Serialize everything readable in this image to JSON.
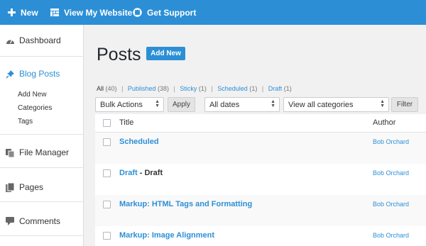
{
  "topbar": {
    "new_label": "New",
    "view_site_label": "View My Website",
    "support_label": "Get Support",
    "icons": [
      "plus-icon",
      "site-grid-icon",
      "lifebuoy-icon"
    ],
    "accent_color": "#2c8fd6"
  },
  "sidebar": {
    "dashboard": "Dashboard",
    "blog_posts": "Blog Posts",
    "sub": [
      "Add New",
      "Categories",
      "Tags"
    ],
    "file_manager": "File Manager",
    "pages": "Pages",
    "comments": "Comments"
  },
  "page": {
    "title": "Posts",
    "add_new": "Add New"
  },
  "filters": {
    "all": "All",
    "all_count": "(40)",
    "published": "Published",
    "published_count": "(38)",
    "sticky": "Sticky",
    "sticky_count": "(1)",
    "scheduled": "Scheduled",
    "scheduled_count": "(1)",
    "draft": "Draft",
    "draft_count": "(1)",
    "separator": "|"
  },
  "toolbar": {
    "bulk_actions": "Bulk Actions",
    "apply": "Apply",
    "dates": "All dates",
    "categories": "View all categories",
    "filter": "Filter"
  },
  "table": {
    "col_title": "Title",
    "col_author": "Author",
    "rows": [
      {
        "title": "Scheduled",
        "state": "",
        "author": "Bob Orchard"
      },
      {
        "title": "Draft",
        "state": "- Draft",
        "author": "Bob Orchard"
      },
      {
        "title": "Markup: HTML Tags and Formatting",
        "state": "",
        "author": "Bob Orchard"
      },
      {
        "title": "Markup: Image Alignment",
        "state": "",
        "author": "Bob Orchard"
      }
    ]
  }
}
